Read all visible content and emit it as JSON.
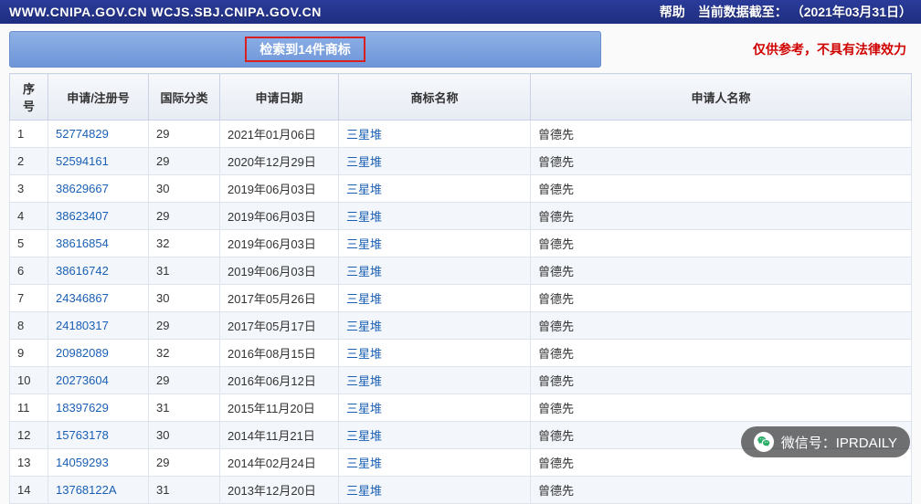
{
  "topbar": {
    "urls": "WWW.CNIPA.GOV.CN WCJS.SBJ.CNIPA.GOV.CN",
    "help": "帮助",
    "data_until_label": "当前数据截至：",
    "data_until_value": "（2021年03月31日）"
  },
  "summary": {
    "count_text": "检索到14件商标",
    "disclaimer": "仅供参考，不具有法律效力"
  },
  "columns": {
    "seq": "序号",
    "reg": "申请/注册号",
    "cls": "国际分类",
    "date": "申请日期",
    "name": "商标名称",
    "applicant": "申请人名称"
  },
  "rows": [
    {
      "seq": "1",
      "reg": "52774829",
      "cls": "29",
      "date": "2021年01月06日",
      "name": "三星堆",
      "applicant": "曾德先"
    },
    {
      "seq": "2",
      "reg": "52594161",
      "cls": "29",
      "date": "2020年12月29日",
      "name": "三星堆",
      "applicant": "曾德先"
    },
    {
      "seq": "3",
      "reg": "38629667",
      "cls": "30",
      "date": "2019年06月03日",
      "name": "三星堆",
      "applicant": "曾德先"
    },
    {
      "seq": "4",
      "reg": "38623407",
      "cls": "29",
      "date": "2019年06月03日",
      "name": "三星堆",
      "applicant": "曾德先"
    },
    {
      "seq": "5",
      "reg": "38616854",
      "cls": "32",
      "date": "2019年06月03日",
      "name": "三星堆",
      "applicant": "曾德先"
    },
    {
      "seq": "6",
      "reg": "38616742",
      "cls": "31",
      "date": "2019年06月03日",
      "name": "三星堆",
      "applicant": "曾德先"
    },
    {
      "seq": "7",
      "reg": "24346867",
      "cls": "30",
      "date": "2017年05月26日",
      "name": "三星堆",
      "applicant": "曾德先"
    },
    {
      "seq": "8",
      "reg": "24180317",
      "cls": "29",
      "date": "2017年05月17日",
      "name": "三星堆",
      "applicant": "曾德先"
    },
    {
      "seq": "9",
      "reg": "20982089",
      "cls": "32",
      "date": "2016年08月15日",
      "name": "三星堆",
      "applicant": "曾德先"
    },
    {
      "seq": "10",
      "reg": "20273604",
      "cls": "29",
      "date": "2016年06月12日",
      "name": "三星堆",
      "applicant": "曾德先"
    },
    {
      "seq": "11",
      "reg": "18397629",
      "cls": "31",
      "date": "2015年11月20日",
      "name": "三星堆",
      "applicant": "曾德先"
    },
    {
      "seq": "12",
      "reg": "15763178",
      "cls": "30",
      "date": "2014年11月21日",
      "name": "三星堆",
      "applicant": "曾德先"
    },
    {
      "seq": "13",
      "reg": "14059293",
      "cls": "29",
      "date": "2014年02月24日",
      "name": "三星堆",
      "applicant": "曾德先"
    },
    {
      "seq": "14",
      "reg": "13768122A",
      "cls": "31",
      "date": "2013年12月20日",
      "name": "三星堆",
      "applicant": "曾德先"
    }
  ],
  "watermark": {
    "label": "微信号：",
    "value": "IPRDAILY"
  }
}
